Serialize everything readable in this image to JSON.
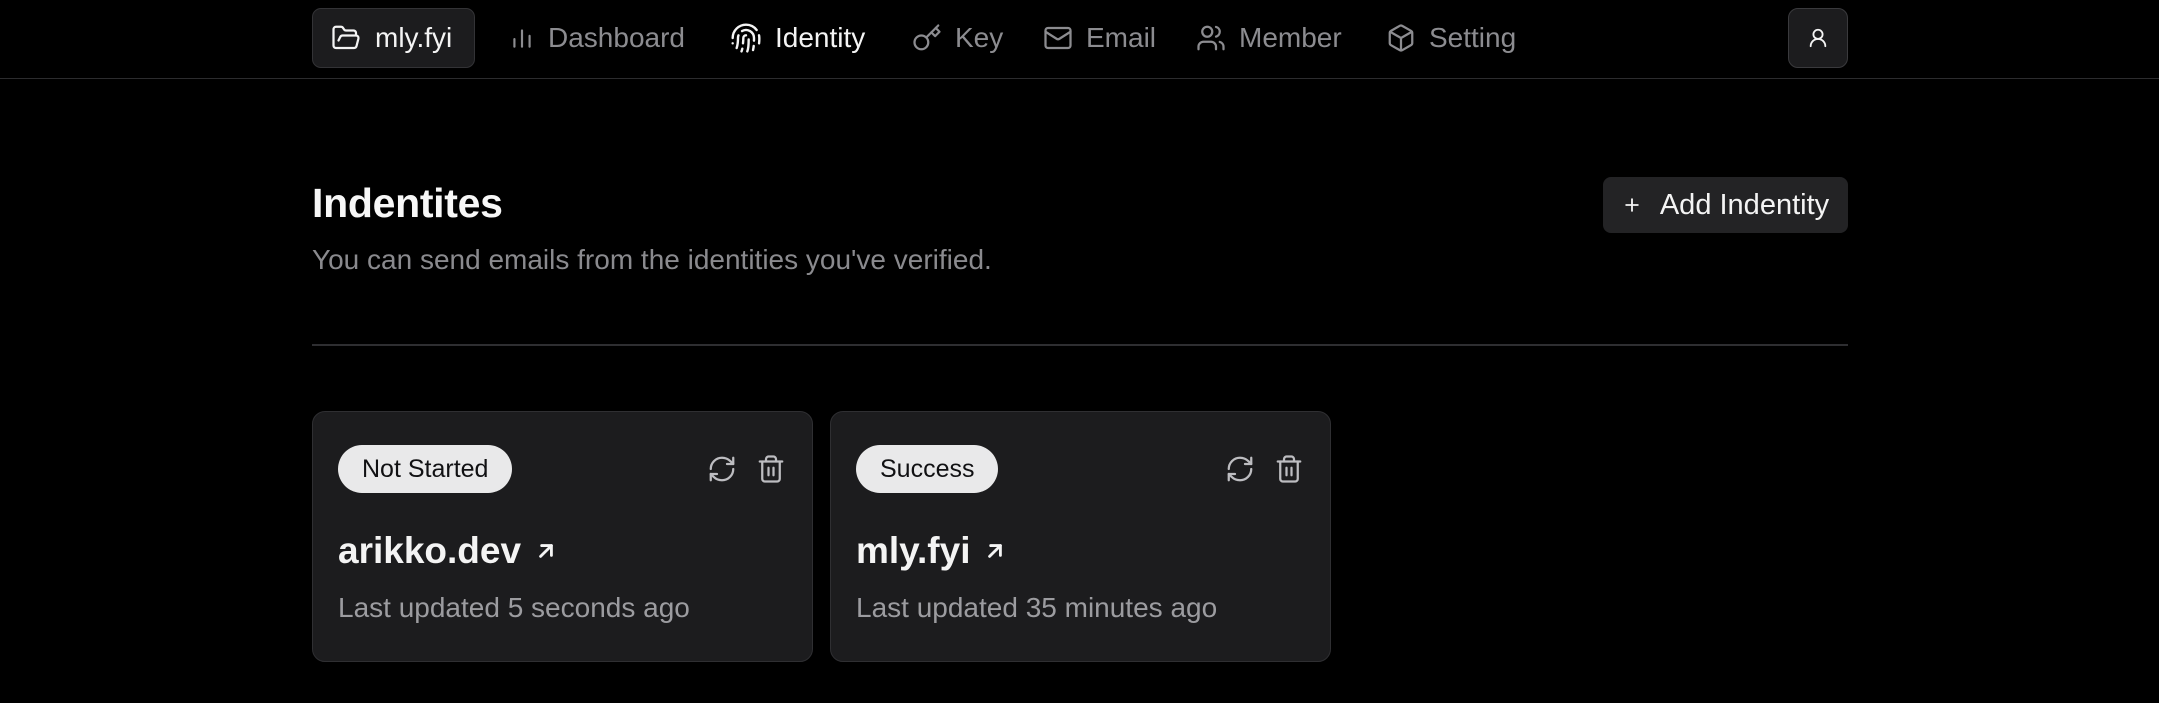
{
  "nav": {
    "brand": {
      "label": "mly.fyi",
      "icon": "folder-open-icon"
    },
    "items": [
      {
        "label": "Dashboard",
        "icon": "bar-chart-icon",
        "active": false
      },
      {
        "label": "Identity",
        "icon": "fingerprint-icon",
        "active": true
      },
      {
        "label": "Key",
        "icon": "key-icon",
        "active": false
      },
      {
        "label": "Email",
        "icon": "mail-icon",
        "active": false
      },
      {
        "label": "Member",
        "icon": "users-icon",
        "active": false
      },
      {
        "label": "Setting",
        "icon": "box-icon",
        "active": false
      }
    ],
    "user_icon": "user-icon"
  },
  "header": {
    "title": "Indentites",
    "subtitle": "You can send emails from the identities you've verified.",
    "add_button": {
      "label": "Add Indentity",
      "icon": "plus-icon"
    }
  },
  "identities": [
    {
      "status": "Not Started",
      "domain": "arikko.dev",
      "updated": "Last updated 5 seconds ago"
    },
    {
      "status": "Success",
      "domain": "mly.fyi",
      "updated": "Last updated 35 minutes ago"
    }
  ],
  "colors": {
    "background": "#000000",
    "surface": "#1c1c1e",
    "border": "#2f2f32",
    "text": "#f4f4f4",
    "muted": "#8a8a8e",
    "badge_bg": "#e9e9ea"
  }
}
